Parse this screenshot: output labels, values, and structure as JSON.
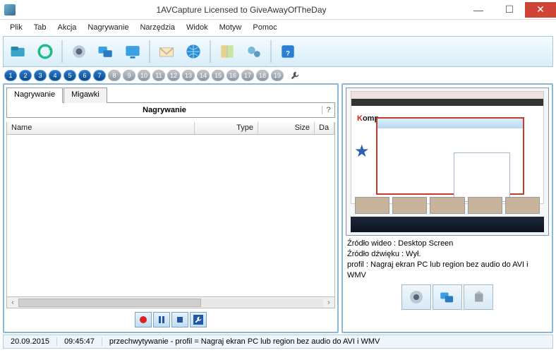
{
  "window": {
    "title": "1AVCapture Licensed to GiveAwayOfTheDay"
  },
  "menu": {
    "items": [
      "Plik",
      "Tab",
      "Akcja",
      "Nagrywanie",
      "Narzędzia",
      "Widok",
      "Motyw",
      "Pomoc"
    ]
  },
  "numbers": {
    "active": [
      1,
      2,
      3,
      4,
      5,
      6,
      7
    ],
    "inactive": [
      8,
      9,
      10,
      11,
      12,
      13,
      14,
      15,
      16,
      17,
      18,
      19
    ]
  },
  "tabs": {
    "record": "Nagrywanie",
    "snap": "Migawki"
  },
  "subheader": {
    "label": "Nagrywanie",
    "help": "?"
  },
  "grid": {
    "name": "Name",
    "type": "Type",
    "size": "Size",
    "da": "Da"
  },
  "scroll": {
    "left": "‹",
    "right": "›"
  },
  "preview": {
    "brand_k": "K",
    "brand_rest": "omp",
    "line1_label": "Źródło wideo : ",
    "line1_val": "Desktop Screen",
    "line2_label": "Źródło dźwięku : ",
    "line2_val": "Wył.",
    "line3_label": "profil : ",
    "line3_val": "Nagraj ekran PC lub region bez audio do AVI i WMV"
  },
  "status": {
    "date": "20.09.2015",
    "time": "09:45:47",
    "text": "przechwytywanie - profil =  Nagraj ekran PC lub region bez audio do AVI i WMV"
  }
}
